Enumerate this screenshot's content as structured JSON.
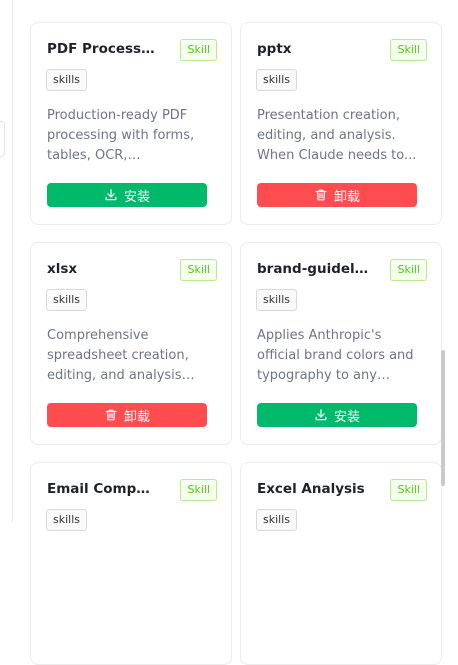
{
  "cards": [
    {
      "title": "PDF Processi...",
      "badge": "Skill",
      "tag": "skills",
      "description": "Production-ready PDF processing with forms, tables, OCR, validation...",
      "action": "安装",
      "action_type": "install"
    },
    {
      "title": "pptx",
      "badge": "Skill",
      "tag": "skills",
      "description": "Presentation creation, editing, and analysis. When Claude needs to...",
      "action": "卸载",
      "action_type": "uninstall"
    },
    {
      "title": "xlsx",
      "badge": "Skill",
      "tag": "skills",
      "description": "Comprehensive spreadsheet creation, editing, and analysis wi...",
      "action": "卸载",
      "action_type": "uninstall"
    },
    {
      "title": "brand-guideli...",
      "badge": "Skill",
      "tag": "skills",
      "description": "Applies Anthropic's official brand colors and typography to any sort...",
      "action": "安装",
      "action_type": "install"
    },
    {
      "title": "Email Composer",
      "badge": "Skill",
      "tag": "skills"
    },
    {
      "title": "Excel Analysis",
      "badge": "Skill",
      "tag": "skills"
    }
  ],
  "colors": {
    "install": "#00b96b",
    "uninstall": "#ff4d4f",
    "skill_badge": "#52c41a"
  },
  "icons": {
    "install": "download-icon",
    "uninstall": "trash-icon"
  }
}
